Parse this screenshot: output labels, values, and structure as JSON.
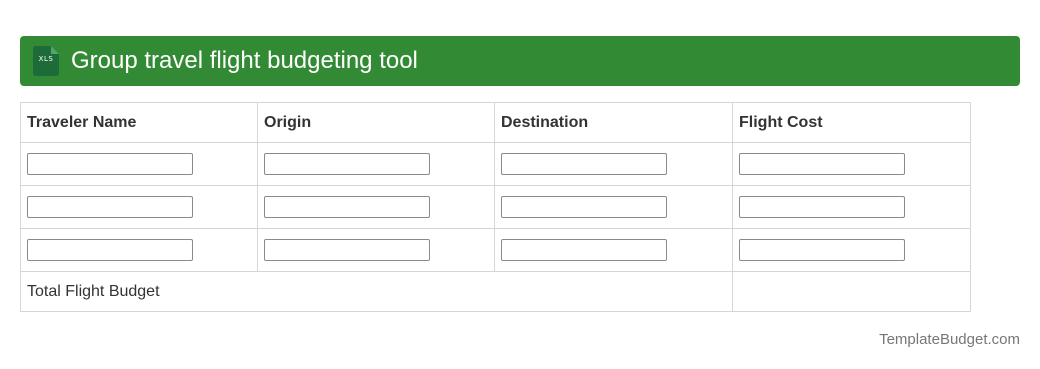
{
  "header": {
    "title": "Group travel flight budgeting tool",
    "icon": "xls-file-icon",
    "icon_label": "XLS",
    "accent_color": "#338a35",
    "icon_color": "#1e6b3a"
  },
  "table": {
    "columns": [
      "Traveler Name",
      "Origin",
      "Destination",
      "Flight Cost"
    ],
    "rows": [
      [
        "",
        "",
        "",
        ""
      ],
      [
        "",
        "",
        "",
        ""
      ],
      [
        "",
        "",
        "",
        ""
      ]
    ],
    "total_label": "Total Flight Budget",
    "total_value": ""
  },
  "footer": {
    "brand": "TemplateBudget.com"
  }
}
